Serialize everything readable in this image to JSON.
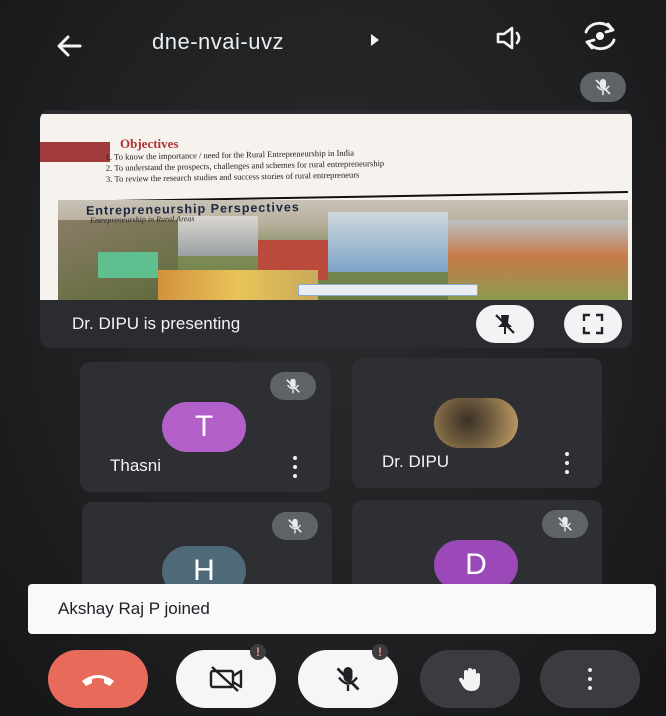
{
  "header": {
    "meeting_code": "dne-nvai-uvz"
  },
  "presentation": {
    "slide": {
      "title": "Objectives",
      "objectives": [
        "To know the importance / need for the Rural Entrepreneurship in India",
        "To understand the prospects, challenges and schemes for rural entrepreneurship",
        "To review the research studies and success stories of  rural entrepreneurs"
      ],
      "subtitle": "Entrepreneurship Perspectives",
      "subtitle_secondary": "Entrepreneurship in Rural Areas"
    },
    "presenting_text": "Dr. DIPU is presenting"
  },
  "participants": [
    {
      "name": "Thasni",
      "initial": "T",
      "avatar_color": "#b25fc9"
    },
    {
      "name": "Dr. DIPU",
      "initial": "",
      "avatar_color": "#7a6a4a"
    },
    {
      "name": "",
      "initial": "H",
      "avatar_color": "#4e6a78"
    },
    {
      "name": "",
      "initial": "D",
      "avatar_color": "#9b49b8"
    }
  ],
  "toast": {
    "message": "Akshay Raj P joined"
  },
  "controls": {
    "camera_alert": "!",
    "mic_alert": "!"
  },
  "colors": {
    "end_call": "#e86a5a",
    "background": "#1f2022",
    "tile": "#2e2f32"
  }
}
